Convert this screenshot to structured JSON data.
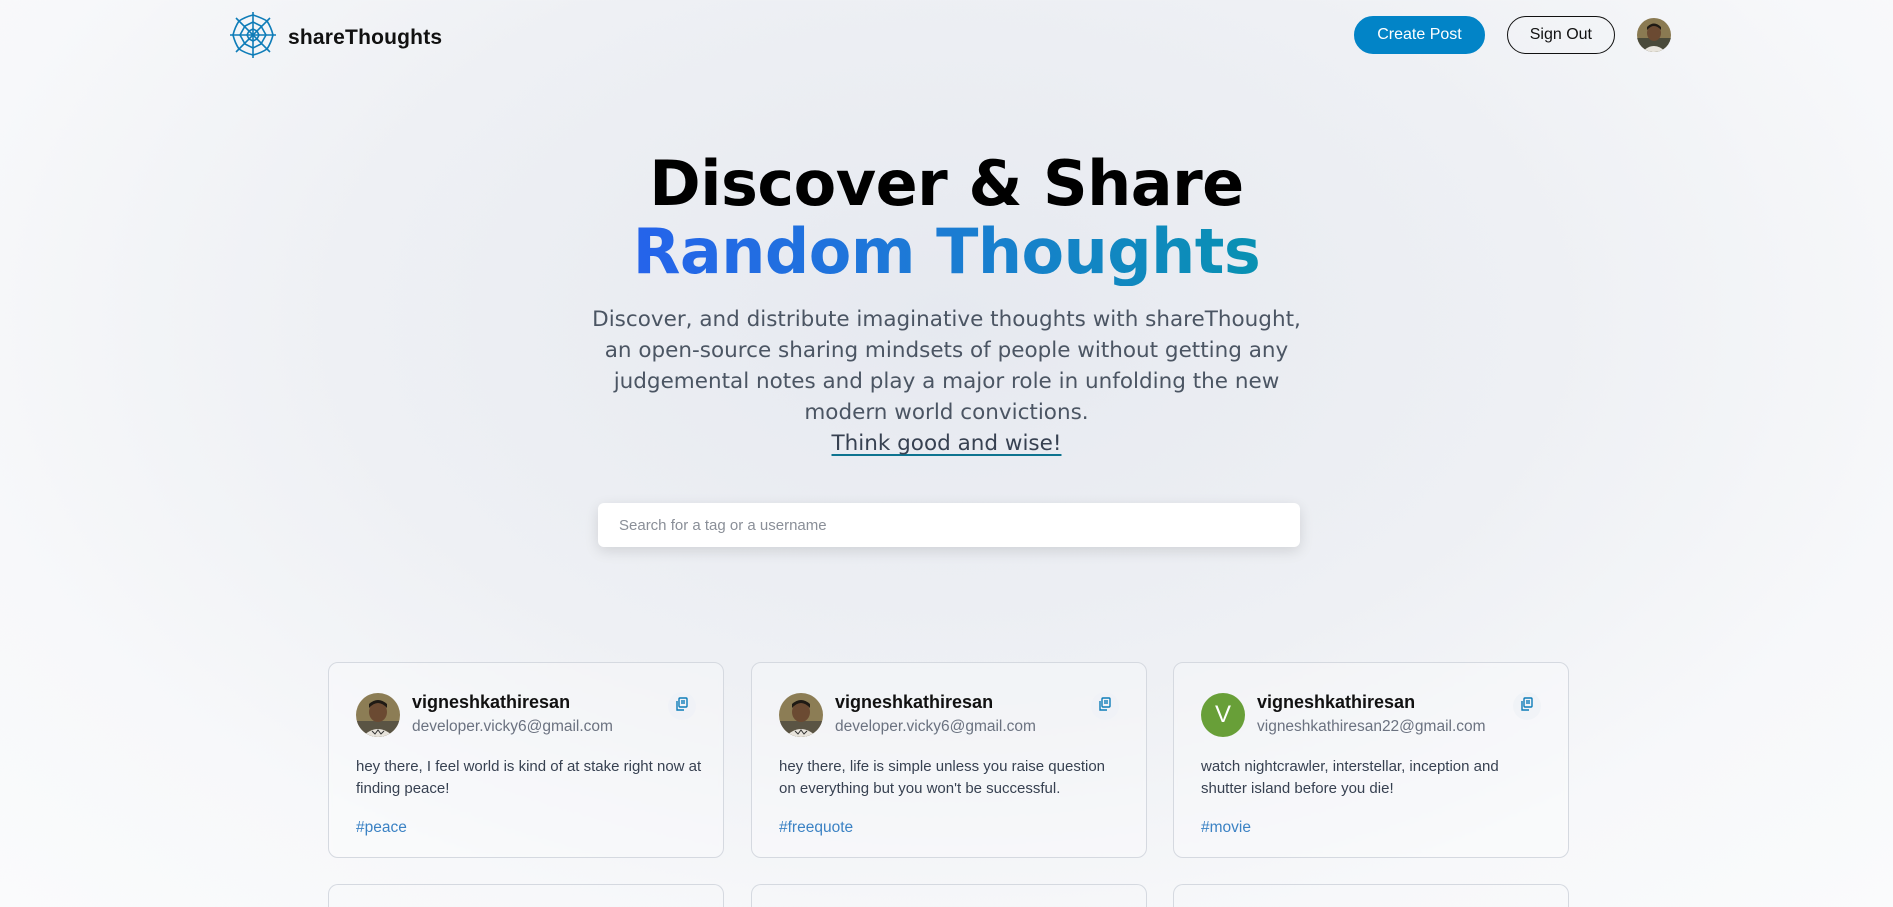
{
  "brand": {
    "name": "shareThoughts"
  },
  "nav": {
    "create_label": "Create Post",
    "signout_label": "Sign Out"
  },
  "hero": {
    "title_line1": "Discover & Share",
    "title_line2": "Random Thoughts",
    "description": "Discover, and distribute imaginative thoughts with shareThought, an open-source sharing mindsets of people without getting any judgemental notes and play a major role in unfolding the new modern world convictions.",
    "link_text": "Think good and wise!"
  },
  "search": {
    "placeholder": "Search for a tag or a username"
  },
  "posts": [
    {
      "username": "vigneshkathiresan",
      "email": "developer.vicky6@gmail.com",
      "text": "hey there, I feel world is kind of at stake right now at finding peace!",
      "tag": "#peace"
    },
    {
      "username": "vigneshkathiresan",
      "email": "developer.vicky6@gmail.com",
      "text": "hey there, life is simple unless you raise question on everything but you won't be successful.",
      "tag": "#freequote"
    },
    {
      "username": "vigneshkathiresan",
      "email": "vigneshkathiresan22@gmail.com",
      "text": "watch nightcrawler, interstellar, inception and shutter island before you die!",
      "tag": "#movie",
      "avatar_letter": "V"
    }
  ],
  "colors": {
    "primary": "#0284c7",
    "gradient_start": "#2563eb",
    "gradient_end": "#0891b2",
    "tag": "#3b82c4"
  },
  "icons": [
    "web-logo-icon",
    "copy-icon"
  ]
}
